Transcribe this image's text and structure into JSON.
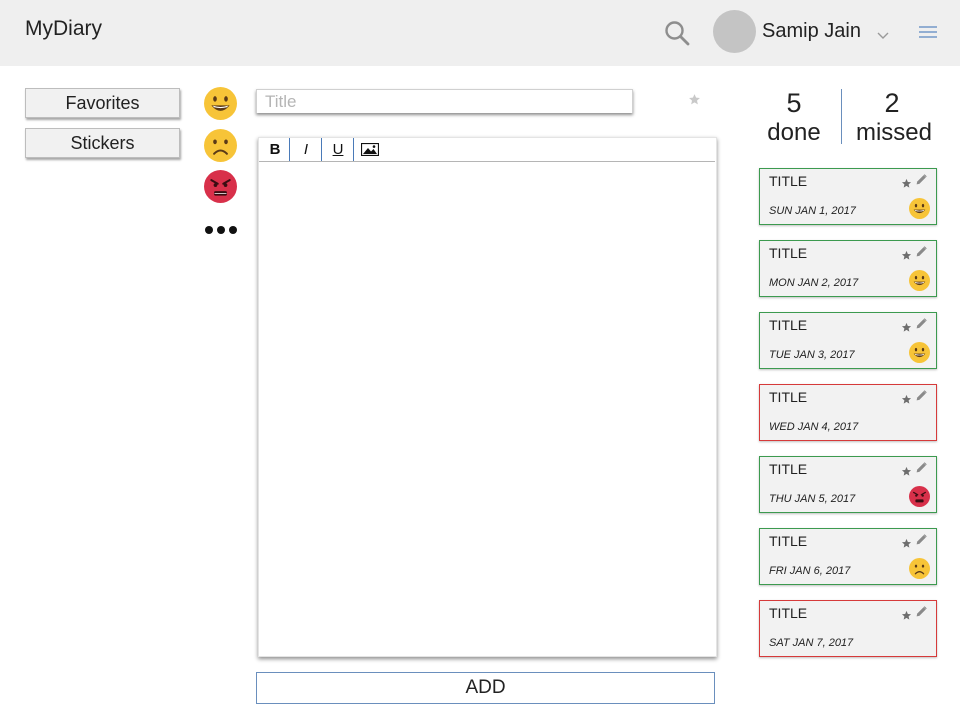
{
  "header": {
    "app_title": "MyDiary",
    "user_name": "Samip Jain",
    "icons": [
      "search-icon",
      "avatar",
      "chevron-down-icon",
      "hamburger-menu-icon"
    ]
  },
  "sidebar": {
    "favorites_label": "Favorites",
    "stickers_label": "Stickers"
  },
  "moods": {
    "items": [
      "happy",
      "sad",
      "angry"
    ],
    "more_label": "more"
  },
  "editor": {
    "title_placeholder": "Title",
    "title_value": "",
    "toolbar": {
      "bold_label": "B",
      "italic_label": "I",
      "underline_label": "U",
      "image_icon": "image-icon"
    },
    "body_value": ""
  },
  "add_button_label": "ADD",
  "stats": {
    "done_count": "5",
    "done_label": "done",
    "missed_count": "2",
    "missed_label": "missed"
  },
  "entries": [
    {
      "title": "TITLE",
      "date": "SUN JAN 1, 2017",
      "status": "done",
      "mood": "happy"
    },
    {
      "title": "TITLE",
      "date": "MON JAN 2, 2017",
      "status": "done",
      "mood": "happy"
    },
    {
      "title": "TITLE",
      "date": "TUE JAN 3, 2017",
      "status": "done",
      "mood": "happy"
    },
    {
      "title": "TITLE",
      "date": "WED JAN 4, 2017",
      "status": "missed",
      "mood": ""
    },
    {
      "title": "TITLE",
      "date": "THU JAN 5, 2017",
      "status": "done",
      "mood": "angry"
    },
    {
      "title": "TITLE",
      "date": "FRI JAN 6, 2017",
      "status": "done",
      "mood": "sad"
    },
    {
      "title": "TITLE",
      "date": "SAT JAN 7, 2017",
      "status": "missed",
      "mood": ""
    }
  ],
  "colors": {
    "header_bg": "#efefef",
    "done_border": "#3c9a4f",
    "missed_border": "#d63a3a",
    "accent_blue": "#6a8fbd",
    "mood_yellow": "#f7c438",
    "mood_red": "#d8304a"
  }
}
